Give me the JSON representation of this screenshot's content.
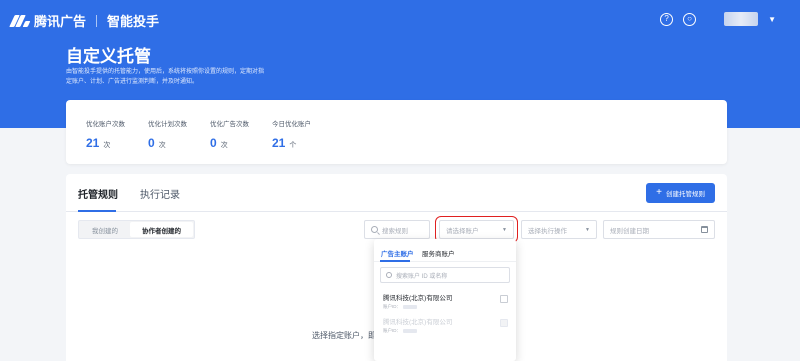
{
  "colors": {
    "brand": "#2f6ee6",
    "highlight": "#e02020"
  },
  "header": {
    "brand": "腾讯广告",
    "product": "智能投手",
    "icons": [
      "help-circle-icon",
      "notification-icon"
    ]
  },
  "hero": {
    "title": "自定义托管",
    "description": "由智能投手提供的托管能力，使用后，系统将按照你设置的规则，定期对指定账户、计划、广告进行监测判断，并及时通知。"
  },
  "stats": [
    {
      "label": "优化账户次数",
      "value": "21",
      "unit": "次"
    },
    {
      "label": "优化计划次数",
      "value": "0",
      "unit": "次"
    },
    {
      "label": "优化广告次数",
      "value": "0",
      "unit": "次"
    },
    {
      "label": "今日优化账户",
      "value": "21",
      "unit": "个"
    }
  ],
  "tabs": [
    {
      "label": "托管规则",
      "active": true
    },
    {
      "label": "执行记录",
      "active": false
    }
  ],
  "create_button": "创建托管规则",
  "segment": [
    "我创建的",
    "协作者创建的"
  ],
  "filters": {
    "search_placeholder": "搜索规则",
    "account_placeholder": "请选择账户",
    "action_placeholder": "选择执行操作",
    "date_placeholder": "规则创建日期"
  },
  "empty_text": "选择指定账户，即",
  "dropdown": {
    "tabs": [
      "广告主账户",
      "服务商账户"
    ],
    "search_placeholder": "搜索账户 ID 或名称",
    "items": [
      {
        "name": "腾讯科技(北京)有限公司",
        "account_label": "账户ID：",
        "disabled": false
      },
      {
        "name": "腾讯科技(北京)有限公司",
        "account_label": "账户ID：",
        "disabled": true
      }
    ]
  }
}
